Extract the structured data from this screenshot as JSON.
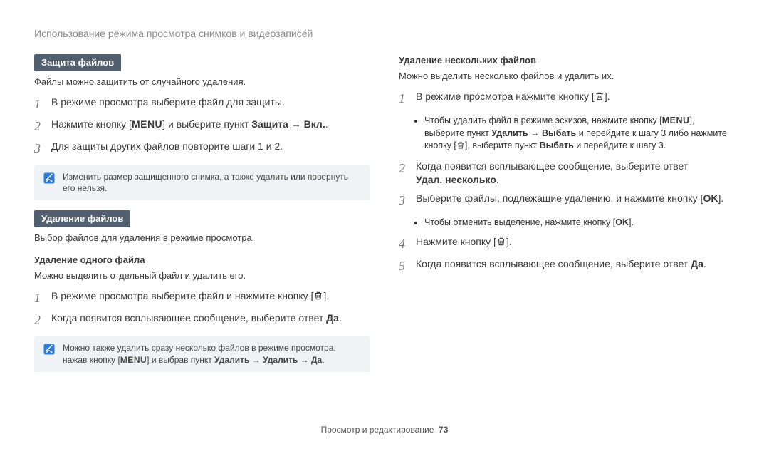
{
  "breadcrumb": "Использование режима просмотра снимков и видеозаписей",
  "left": {
    "section1": {
      "badge": "Защита файлов",
      "intro": "Файлы можно защитить от случайного удаления.",
      "step1": "В режиме просмотра выберите файл для защиты.",
      "step2_a": "Нажмите кнопку [",
      "step2_menu": "MENU",
      "step2_b": "] и выберите пункт ",
      "step2_bold": "Защита → Вкл.",
      "step2_c": ".",
      "step3": "Для защиты других файлов повторите шаги 1 и 2.",
      "note": "Изменить размер защищенного снимка, а также удалить или повернуть его нельзя."
    },
    "section2": {
      "badge": "Удаление файлов",
      "intro": "Выбор файлов для удаления в режиме просмотра.",
      "subhead": "Удаление одного файла",
      "subintro": "Можно выделить отдельный файл и удалить его.",
      "step1_a": "В режиме просмотра выберите файл и нажмите кнопку [",
      "step1_b": "].",
      "step2_a": "Когда появится всплывающее сообщение, выберите ответ ",
      "step2_bold": "Да",
      "step2_b": ".",
      "note_a": "Можно также удалить сразу несколько файлов в режиме просмотра, нажав кнопку [",
      "note_menu": "MENU",
      "note_b": "] и выбрав пункт ",
      "note_bold": "Удалить → Удалить → Да",
      "note_c": "."
    }
  },
  "right": {
    "subhead": "Удаление нескольких файлов",
    "intro": "Можно выделить несколько файлов и удалить их.",
    "step1_a": "В режиме просмотра нажмите кнопку [",
    "step1_b": "].",
    "bullet1_a": "Чтобы удалить файл в режиме эскизов, нажмите кнопку [",
    "bullet1_menu": "MENU",
    "bullet1_b": "], выберите пункт ",
    "bullet1_bold1": "Удалить → Выбать",
    "bullet1_c": " и перейдите к шагу 3 либо нажмите кнопку [",
    "bullet1_d": "], выберите пункт ",
    "bullet1_bold2": "Выбать",
    "bullet1_e": " и перейдите к шагу 3.",
    "step2_a": "Когда появится всплывающее сообщение, выберите ответ ",
    "step2_bold": "Удал. несколько",
    "step2_b": ".",
    "step3_a": "Выберите файлы, подлежащие удалению, и нажмите кнопку [",
    "step3_ok": "OK",
    "step3_b": "].",
    "bullet3_a": "Чтобы отменить выделение, нажмите кнопку [",
    "bullet3_ok": "OK",
    "bullet3_b": "].",
    "step4_a": "Нажмите кнопку [",
    "step4_b": "].",
    "step5_a": "Когда появится всплывающее сообщение, выберите ответ ",
    "step5_bold": "Да",
    "step5_b": "."
  },
  "footer": {
    "label": "Просмотр и редактирование",
    "page": "73"
  }
}
